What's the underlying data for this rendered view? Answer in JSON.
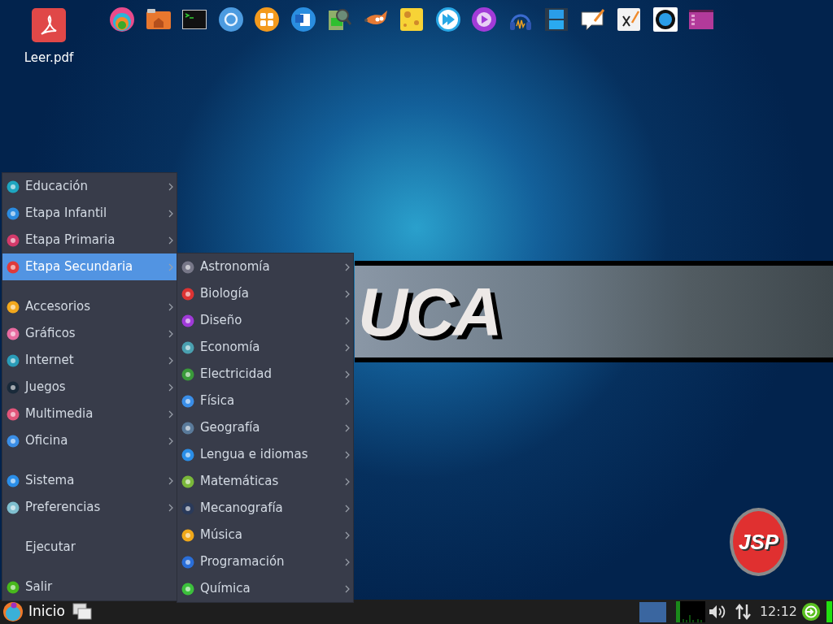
{
  "desktop_icons": [
    {
      "label": "Leer.pdf"
    }
  ],
  "wallpaper": {
    "banner_text": "UCA",
    "logo_text": "JSP"
  },
  "menu": {
    "groups": [
      [
        {
          "label": "Educación",
          "selected": false,
          "submenu": true
        },
        {
          "label": "Etapa Infantil",
          "selected": false,
          "submenu": true
        },
        {
          "label": "Etapa Primaria",
          "selected": false,
          "submenu": true
        },
        {
          "label": "Etapa Secundaria",
          "selected": true,
          "submenu": true
        }
      ],
      [
        {
          "label": "Accesorios",
          "selected": false,
          "submenu": true
        },
        {
          "label": "Gráficos",
          "selected": false,
          "submenu": true
        },
        {
          "label": "Internet",
          "selected": false,
          "submenu": true
        },
        {
          "label": "Juegos",
          "selected": false,
          "submenu": true
        },
        {
          "label": "Multimedia",
          "selected": false,
          "submenu": true
        },
        {
          "label": "Oficina",
          "selected": false,
          "submenu": true
        }
      ],
      [
        {
          "label": "Sistema",
          "selected": false,
          "submenu": true
        },
        {
          "label": "Preferencias",
          "selected": false,
          "submenu": true
        }
      ],
      [
        {
          "label": "Ejecutar",
          "selected": false,
          "submenu": false
        }
      ],
      [
        {
          "label": "Salir",
          "selected": false,
          "submenu": false
        }
      ]
    ]
  },
  "submenu": {
    "items": [
      {
        "label": "Astronomía",
        "submenu": true
      },
      {
        "label": "Biología",
        "submenu": true
      },
      {
        "label": "Diseño",
        "submenu": true
      },
      {
        "label": "Economía",
        "submenu": true
      },
      {
        "label": "Electricidad",
        "submenu": true
      },
      {
        "label": "Física",
        "submenu": true
      },
      {
        "label": "Geografía",
        "submenu": true
      },
      {
        "label": "Lengua e idiomas",
        "submenu": true
      },
      {
        "label": "Matemáticas",
        "submenu": true
      },
      {
        "label": "Mecanografía",
        "submenu": true
      },
      {
        "label": "Música",
        "submenu": true
      },
      {
        "label": "Programación",
        "submenu": true
      },
      {
        "label": "Química",
        "submenu": true
      }
    ]
  },
  "taskbar": {
    "start_label": "Inicio",
    "clock": "12:12"
  }
}
